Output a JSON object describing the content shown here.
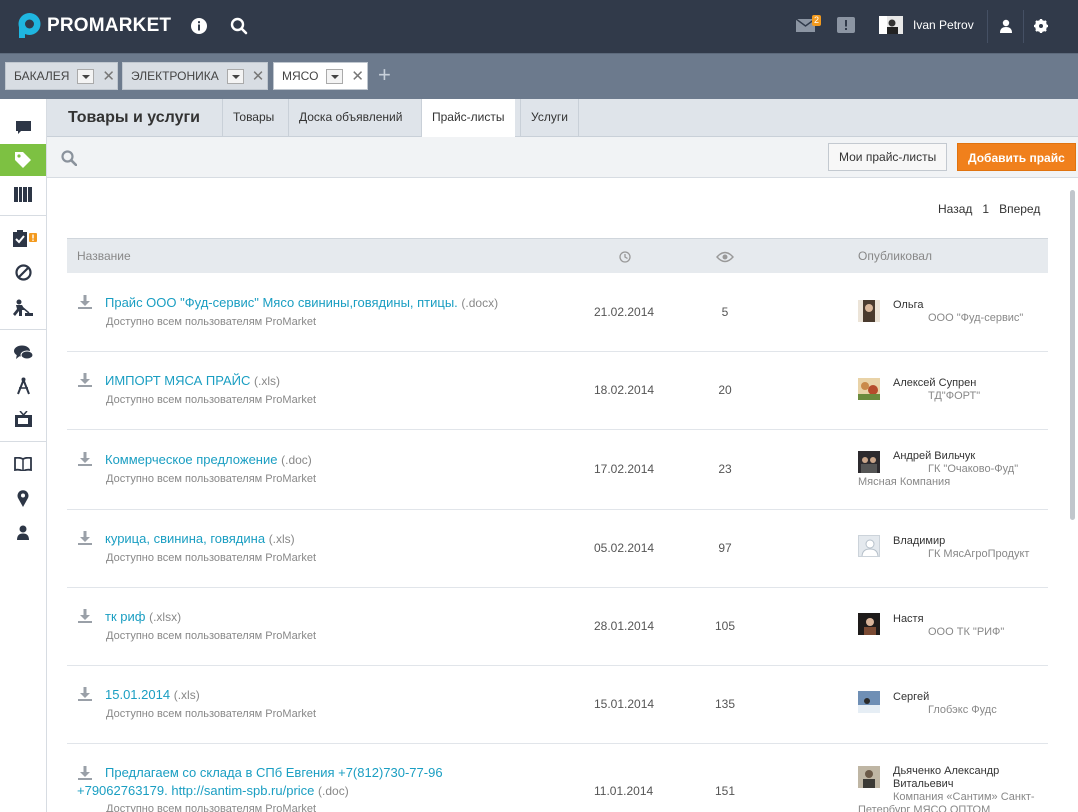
{
  "app": {
    "brand": "PROMARKET"
  },
  "topbar": {
    "messages_badge": "2",
    "user_name": "Ivan Petrov"
  },
  "filter_tabs": [
    {
      "label": "БАКАЛЕЯ"
    },
    {
      "label": "ЭЛЕКТРОНИКА"
    },
    {
      "label": "МЯСО"
    }
  ],
  "section": {
    "title": "Товары и услуги",
    "tabs": [
      "Товары",
      "Доска объявлений",
      "Прайс-листы",
      "Услуги"
    ],
    "active_tab": "Прайс-листы"
  },
  "toolbar": {
    "my_prices_label": "Мои прайс-листы",
    "add_price_label": "Добавить прайс"
  },
  "pager": {
    "back": "Назад",
    "page": "1",
    "forward": "Вперед"
  },
  "table": {
    "headers": {
      "name": "Название",
      "published_by": "Опубликовал"
    },
    "rows": [
      {
        "title": "Прайс ООО \"Фуд-сервис\" Мясо свинины,говядины, птицы.",
        "ext": "(.docx)",
        "access": "Доступно всем пользователям ProMarket",
        "date": "21.02.2014",
        "views": "5",
        "author": "Ольга",
        "company": "ООО \"Фуд-сервис\""
      },
      {
        "title": "ИМПОРТ МЯСА ПРАЙС",
        "ext": "(.xls)",
        "access": "Доступно всем пользователям ProMarket",
        "date": "18.02.2014",
        "views": "20",
        "author": "Алексей Супрен",
        "company": "ТД\"ФОРТ\""
      },
      {
        "title": "Коммерческое предложение",
        "ext": "(.doc)",
        "access": "Доступно всем пользователям ProMarket",
        "date": "17.02.2014",
        "views": "23",
        "author": "Андрей Вильчук",
        "company": "ГК \"Очаково-Фуд\"",
        "company_line2": "Мясная Компания"
      },
      {
        "title": "курица, свинина, говядина",
        "ext": "(.xls)",
        "access": "Доступно всем пользователям ProMarket",
        "date": "05.02.2014",
        "views": "97",
        "author": "Владимир",
        "company": "ГК МясАгроПродукт"
      },
      {
        "title": "тк риф",
        "ext": "(.xlsx)",
        "access": "Доступно всем пользователям ProMarket",
        "date": "28.01.2014",
        "views": "105",
        "author": "Настя",
        "company": "ООО ТК \"РИФ\""
      },
      {
        "title": "15.01.2014",
        "ext": "(.xls)",
        "access": "Доступно всем пользователям ProMarket",
        "date": "15.01.2014",
        "views": "135",
        "author": "Сергей",
        "company": "Глобэкс Фудс"
      },
      {
        "title": "Предлагаем со склада в СПб Евгения +7(812)730-77-96",
        "title_line2": "+79062763179. http://santim-spb.ru/price",
        "ext": "(.doc)",
        "access": "Доступно всем пользователям ProMarket",
        "date": "11.01.2014",
        "views": "151",
        "author": "Дьяченко Александр",
        "author_line2": "Витальевич",
        "company": "Компания «Сантим» Санкт-",
        "company_line2": "Петербург МЯСО ОПТОМ"
      }
    ]
  },
  "colors": {
    "topbar": "#313a4a",
    "accent_green": "#7dc142",
    "accent_orange": "#f0801c",
    "link": "#1a9ec2"
  },
  "icons": [
    "logo-mark-icon",
    "info-icon",
    "search-icon",
    "mail-icon",
    "alert-icon",
    "user-icon",
    "gear-icon",
    "chat-icon",
    "tag-icon",
    "catalog-icon",
    "clipboard-check-icon",
    "block-icon",
    "worker-icon",
    "chat-bubbles-icon",
    "compass-icon",
    "tv-icon",
    "book-icon",
    "location-pin-icon",
    "person-icon",
    "clock-icon",
    "eye-icon",
    "download-icon"
  ]
}
